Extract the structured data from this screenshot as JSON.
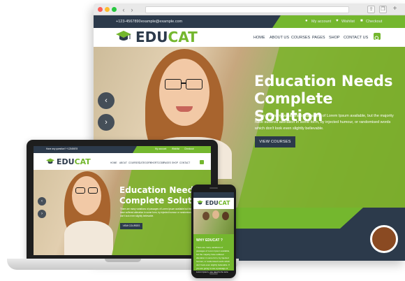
{
  "browser": {
    "topbar": {
      "phone": "+123-4567890",
      "email": "example@example.com",
      "links": [
        "My account",
        "Wishlist",
        "Checkout"
      ]
    },
    "logo": {
      "part1": "EDU",
      "part2": "CAT"
    },
    "nav": [
      "HOME",
      "ABOUT US",
      "COURSES",
      "PAGES",
      "SHOP",
      "CONTACT US"
    ],
    "hero": {
      "title": "Education Needs Complete Solution",
      "description": "There are many variations of passages of Lorem Ipsum available, but the majority have suffered alteration in some form, by injected humour, or randomised words which don't look even slightly believable.",
      "button": "VIEW COURSES",
      "prev": "‹",
      "next": "›"
    }
  },
  "laptop": {
    "topbar": {
      "phone": "Have any question? +12345678",
      "links": [
        "My account",
        "Wishlist",
        "Checkout"
      ]
    },
    "logo": {
      "part1": "EDU",
      "part2": "CAT"
    },
    "nav": [
      "HOME",
      "ABOUT",
      "COURSES",
      "CATEGORY",
      "SHORTCODE",
      "PAGES",
      "SHOP",
      "CONTACT"
    ],
    "hero": {
      "title": "Education Needs Complete Solution",
      "description": "There are many variations of passages of Lorem Ipsum available but the majority have suffered alteration in some form, by injected humour or randomised words which don't look even slightly believable.",
      "button": "VIEW COURSES",
      "prev": "‹",
      "next": "›"
    }
  },
  "phone": {
    "logo": {
      "part1": "EDU",
      "part2": "CAT"
    },
    "section_title": "WHY EDUCAT ?",
    "section_text": "There are many variations of passages of Lorem Ipsum available, but the majority have suffered alteration in some form, by injected humour, or randomised words which don't look even slightly believable. If you are going to use a passage of Lorem Ipsum, you need to be sure"
  },
  "colors": {
    "navy": "#2c3a4b",
    "green": "#74b72e"
  }
}
